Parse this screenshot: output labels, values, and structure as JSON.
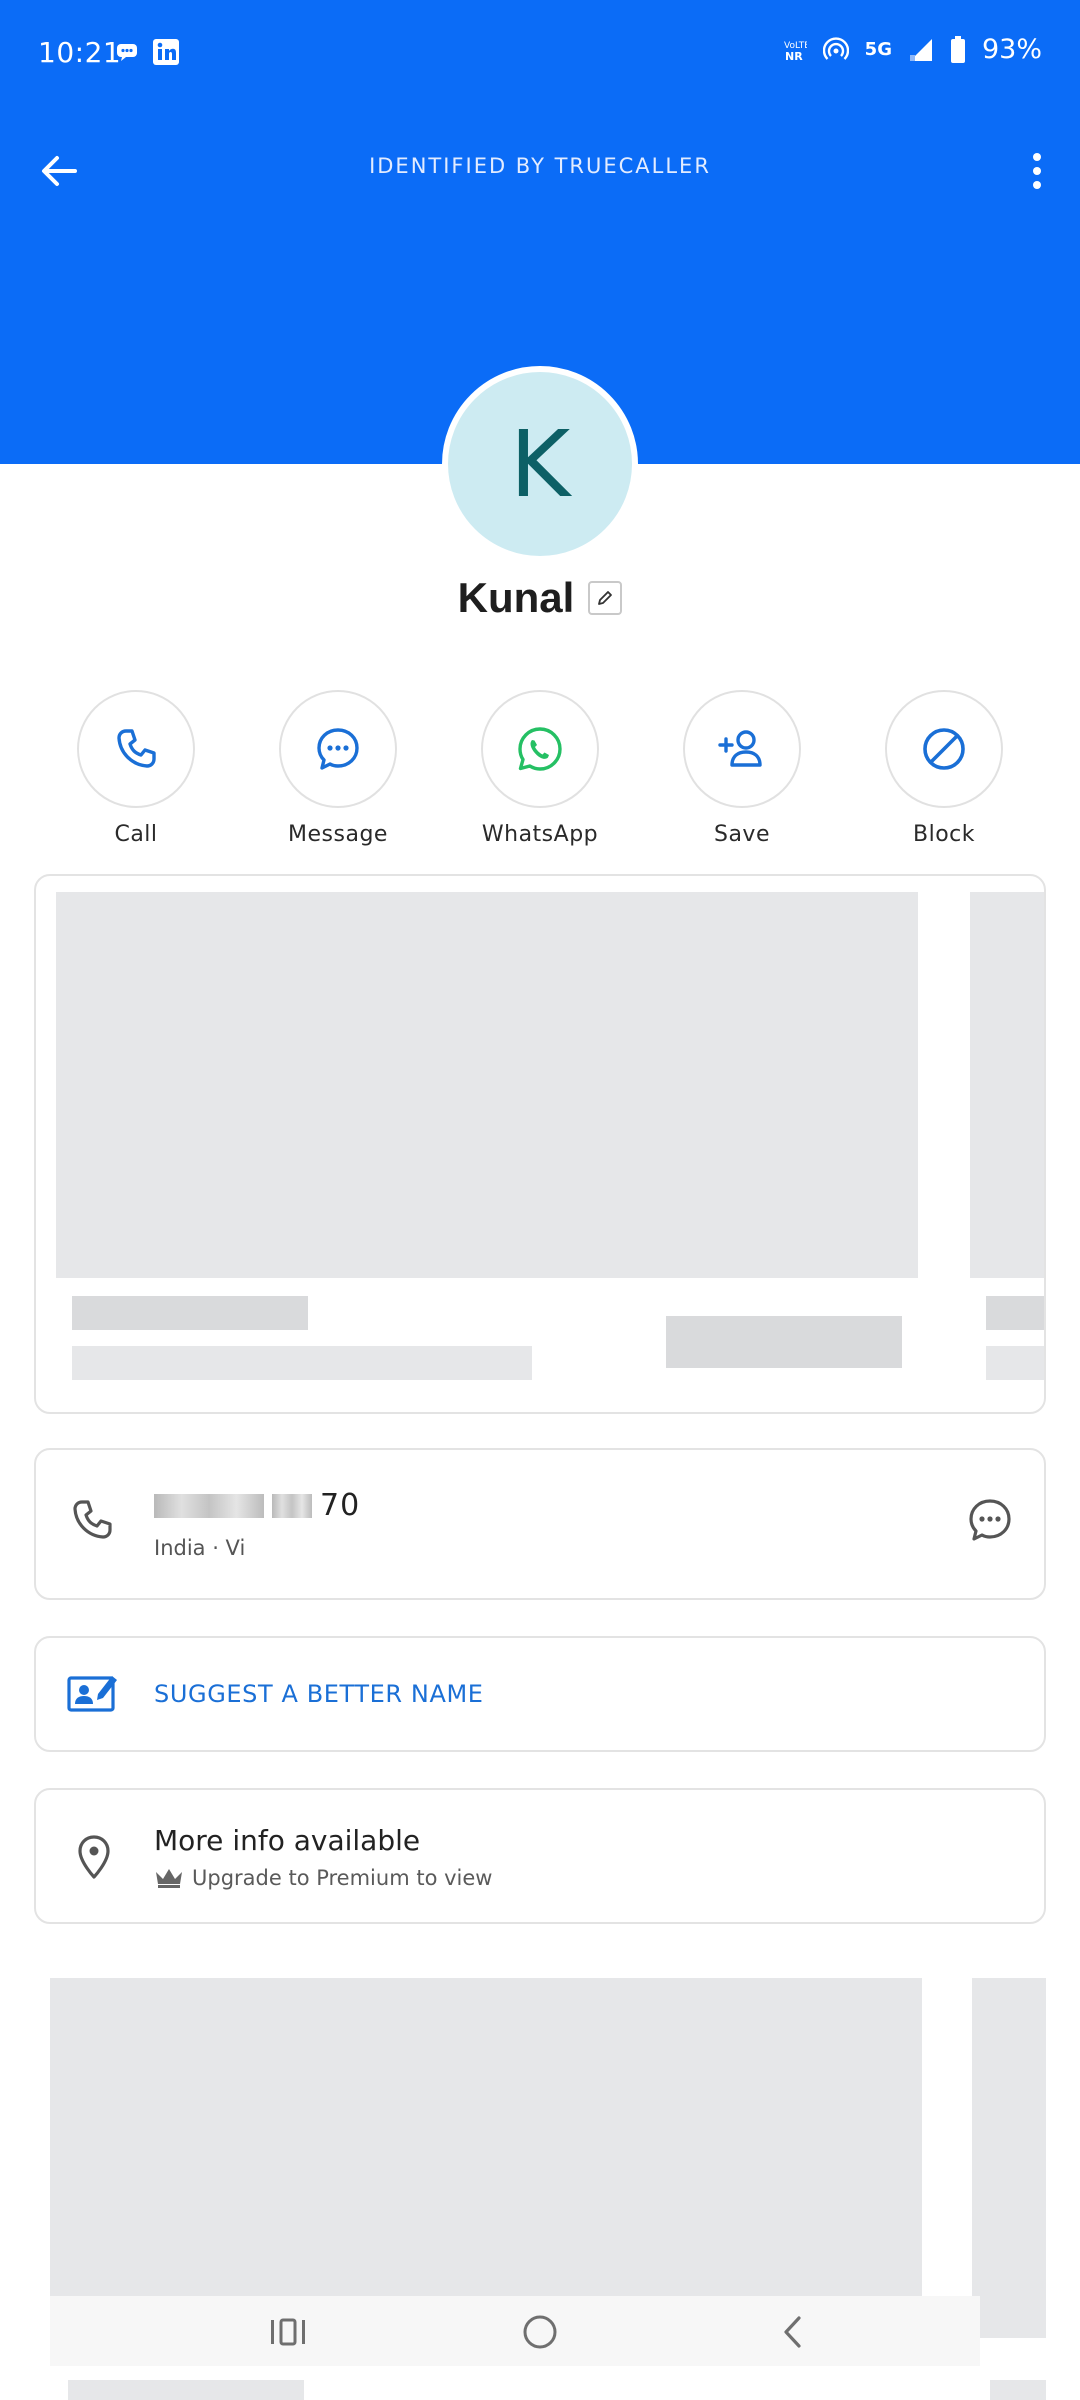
{
  "status_bar": {
    "time": "10:21",
    "network": "5G",
    "battery": "93%"
  },
  "toolbar": {
    "title": "IDENTIFIED BY TRUECALLER"
  },
  "contact": {
    "initial": "K",
    "name": "Kunal"
  },
  "actions": [
    {
      "label": "Call"
    },
    {
      "label": "Message"
    },
    {
      "label": "WhatsApp"
    },
    {
      "label": "Save"
    },
    {
      "label": "Block"
    }
  ],
  "phone": {
    "number_suffix": "70",
    "details": "India · Vi"
  },
  "suggest": {
    "label": "SUGGEST A BETTER NAME"
  },
  "more_info": {
    "title": "More info available",
    "subtitle": "Upgrade to Premium to view"
  },
  "colors": {
    "header_blue": "#0b6cf7",
    "accent_blue": "#1a6fd6",
    "whatsapp_green": "#25c064",
    "avatar_bg": "#cdebf2"
  }
}
